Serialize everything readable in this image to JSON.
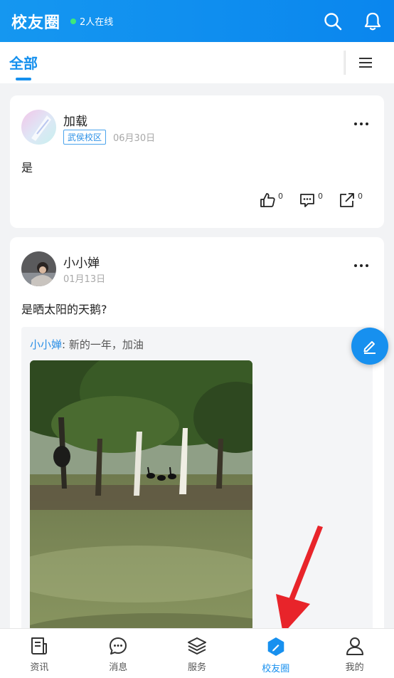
{
  "header": {
    "title": "校友圈",
    "online": "2人在线"
  },
  "tabs": {
    "active": "全部"
  },
  "posts": [
    {
      "author": "加载",
      "campus": "武侯校区",
      "date": "06月30日",
      "text": "是",
      "likes": "0",
      "comments": "0",
      "shares": "0"
    },
    {
      "author": "小小婵",
      "date": "01月13日",
      "text": "是晒太阳的天鹅?",
      "repost_author": "小小婵",
      "repost_sep": ":",
      "repost_text": "新的一年，加油"
    }
  ],
  "nav": [
    {
      "label": "资讯",
      "icon": "news-icon"
    },
    {
      "label": "消息",
      "icon": "message-icon"
    },
    {
      "label": "服务",
      "icon": "layers-icon"
    },
    {
      "label": "校友圈",
      "icon": "alumni-icon",
      "active": true
    },
    {
      "label": "我的",
      "icon": "user-icon"
    }
  ],
  "colors": {
    "primary": "#1790ef",
    "online_dot": "#3ee87a",
    "arrow": "#e8242a"
  }
}
